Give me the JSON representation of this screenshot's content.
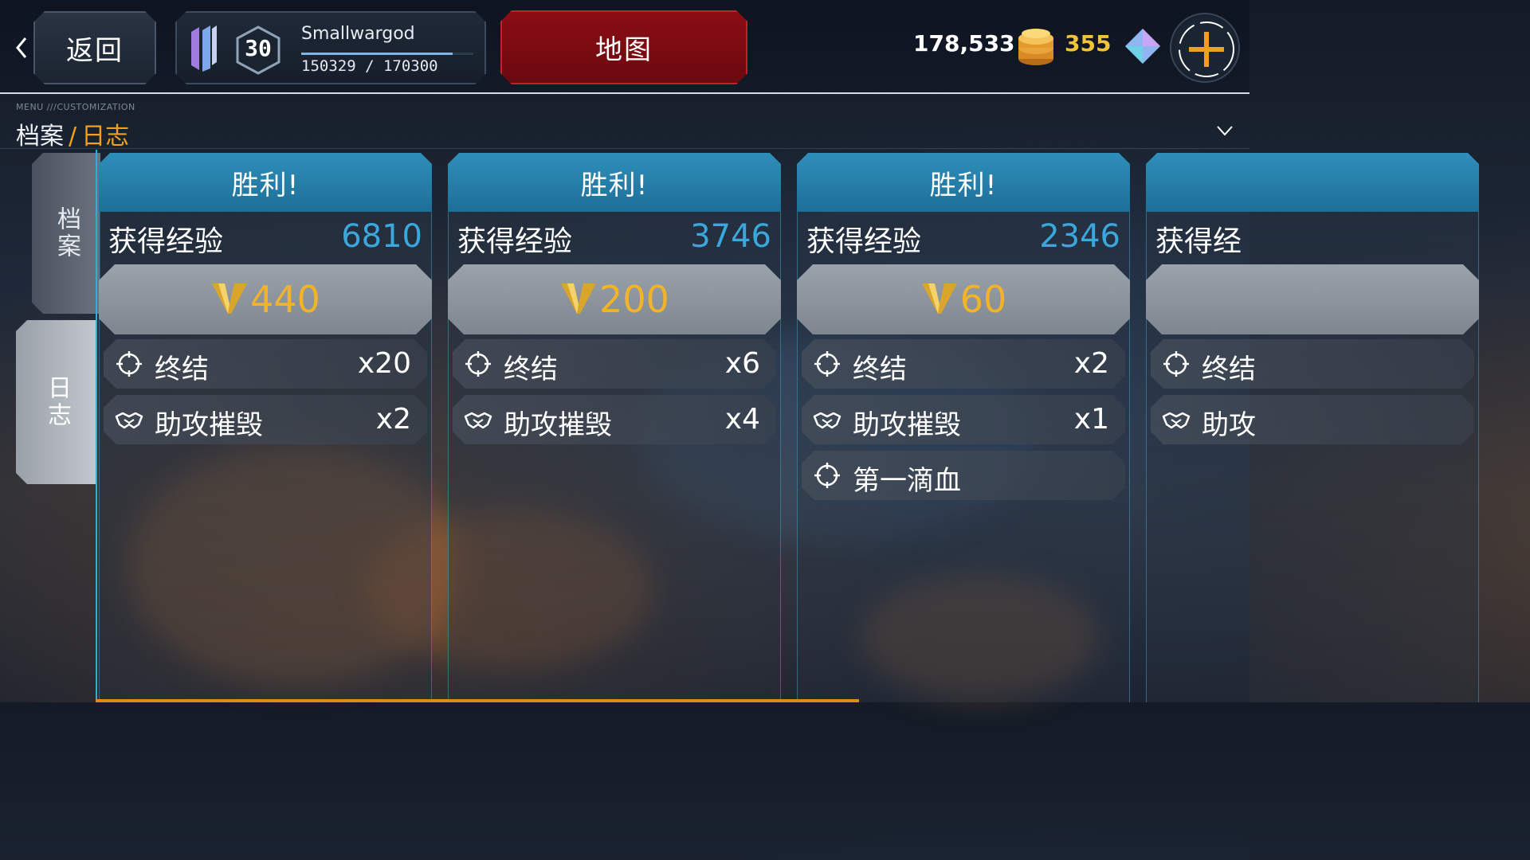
{
  "topbar": {
    "back_label": "返回",
    "player": {
      "level": "30",
      "name": "Smallwargod",
      "xp_text": "150329 / 170300",
      "xp_fraction": 0.88
    },
    "map_label": "地图",
    "currency": {
      "coins": "178,533",
      "gems": "355"
    }
  },
  "breadcrumb": {
    "menu_tag": "MENU ///CUSTOMIZATION",
    "parent": "档案",
    "separator": "/",
    "current": "日志"
  },
  "side_tabs": [
    {
      "label": "档案",
      "active": false
    },
    {
      "label": "日志",
      "active": true
    }
  ],
  "cards": [
    {
      "result": "胜利!",
      "exp_label": "获得经验",
      "exp_value": "6810",
      "reward": "440",
      "stats": [
        {
          "icon": "crosshair-icon",
          "label": "终结",
          "count": "x20"
        },
        {
          "icon": "handshake-icon",
          "label": "助攻摧毁",
          "count": "x2"
        }
      ]
    },
    {
      "result": "胜利!",
      "exp_label": "获得经验",
      "exp_value": "3746",
      "reward": "200",
      "stats": [
        {
          "icon": "crosshair-icon",
          "label": "终结",
          "count": "x6"
        },
        {
          "icon": "handshake-icon",
          "label": "助攻摧毁",
          "count": "x4"
        }
      ]
    },
    {
      "result": "胜利!",
      "exp_label": "获得经验",
      "exp_value": "2346",
      "reward": "60",
      "stats": [
        {
          "icon": "crosshair-icon",
          "label": "终结",
          "count": "x2"
        },
        {
          "icon": "handshake-icon",
          "label": "助攻摧毁",
          "count": "x1"
        },
        {
          "icon": "crosshair-icon",
          "label": "第一滴血",
          "count": ""
        }
      ]
    },
    {
      "result": "",
      "exp_label": "获得经",
      "exp_value": "",
      "reward": "",
      "stats": [
        {
          "icon": "crosshair-icon",
          "label": "终结",
          "count": ""
        },
        {
          "icon": "handshake-icon",
          "label": "助攻",
          "count": ""
        }
      ]
    }
  ],
  "colors": {
    "accent_blue": "#2f8fba",
    "exp_blue": "#3aa8dc",
    "gold": "#f0b32a",
    "map_red": "#8c0d14",
    "orange": "#f0a020"
  }
}
